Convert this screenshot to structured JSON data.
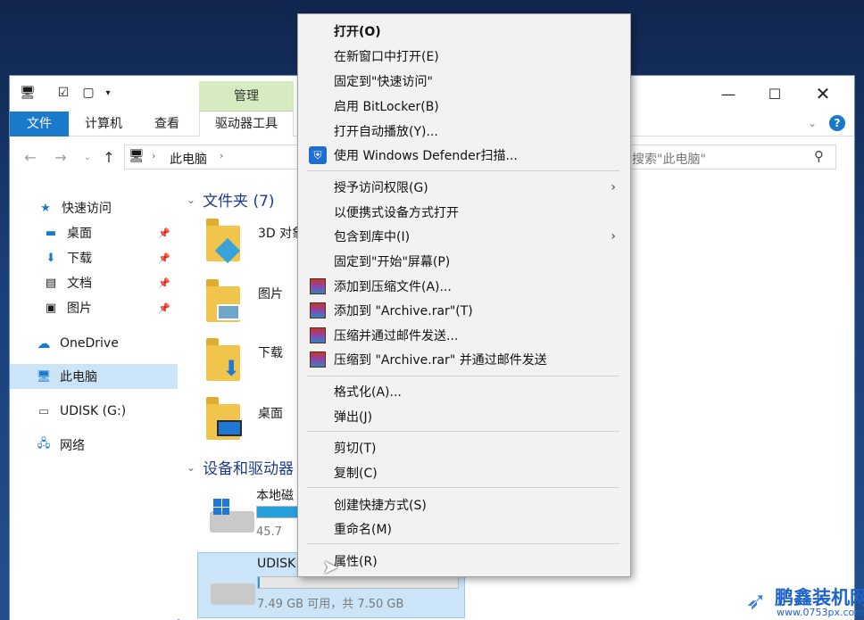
{
  "window": {
    "contextual_tab": "管理",
    "ribbon_tabs": [
      "文件",
      "计算机",
      "查看",
      "驱动器工具"
    ],
    "breadcrumb_current": "此电脑",
    "search_placeholder": "搜索\"此电脑\""
  },
  "sidebar": {
    "items": [
      {
        "label": "快速访问",
        "icon": "star-icon"
      },
      {
        "label": "桌面",
        "icon": "desktop-icon",
        "pinned": true
      },
      {
        "label": "下载",
        "icon": "download-icon",
        "pinned": true
      },
      {
        "label": "文档",
        "icon": "document-icon",
        "pinned": true
      },
      {
        "label": "图片",
        "icon": "pictures-icon",
        "pinned": true
      },
      {
        "label": "OneDrive",
        "icon": "cloud-icon"
      },
      {
        "label": "此电脑",
        "icon": "computer-icon",
        "selected": true
      },
      {
        "label": "UDISK (G:)",
        "icon": "usb-drive-icon"
      },
      {
        "label": "网络",
        "icon": "network-icon"
      }
    ]
  },
  "content": {
    "folders_header": "文件夹 (7)",
    "folders": [
      "3D 对象",
      "图片",
      "下载",
      "桌面"
    ],
    "devices_header": "设备和驱动器",
    "drives": [
      {
        "title": "本地磁",
        "free_text": "45.7",
        "used_fraction": 0.6
      },
      {
        "title": "UDISK",
        "free_text": "7.49 GB 可用，共 7.50 GB",
        "used_fraction": 0.01,
        "selected": true
      }
    ]
  },
  "context_menu": {
    "items": [
      {
        "label": "打开(O)",
        "bold": true
      },
      {
        "label": "在新窗口中打开(E)"
      },
      {
        "label": "固定到\"快速访问\""
      },
      {
        "label": "启用 BitLocker(B)"
      },
      {
        "label": "打开自动播放(Y)..."
      },
      {
        "label": "使用 Windows Defender扫描...",
        "icon": "defender-shield-icon"
      },
      {
        "separator": true
      },
      {
        "label": "授予访问权限(G)",
        "submenu": true
      },
      {
        "label": "以便携式设备方式打开"
      },
      {
        "label": "包含到库中(I)",
        "submenu": true
      },
      {
        "label": "固定到\"开始\"屏幕(P)"
      },
      {
        "label": "添加到压缩文件(A)...",
        "icon": "winrar-icon"
      },
      {
        "label": "添加到 \"Archive.rar\"(T)",
        "icon": "winrar-icon"
      },
      {
        "label": "压缩并通过邮件发送...",
        "icon": "winrar-icon"
      },
      {
        "label": "压缩到 \"Archive.rar\" 并通过邮件发送",
        "icon": "winrar-icon"
      },
      {
        "separator": true
      },
      {
        "label": "格式化(A)..."
      },
      {
        "label": "弹出(J)"
      },
      {
        "separator": true
      },
      {
        "label": "剪切(T)"
      },
      {
        "label": "复制(C)"
      },
      {
        "separator": true
      },
      {
        "label": "创建快捷方式(S)"
      },
      {
        "label": "重命名(M)"
      },
      {
        "separator": true
      },
      {
        "label": "属性(R)"
      }
    ]
  },
  "watermark": {
    "title": "鹏鑫装机网",
    "url": "www.0753px.com"
  }
}
